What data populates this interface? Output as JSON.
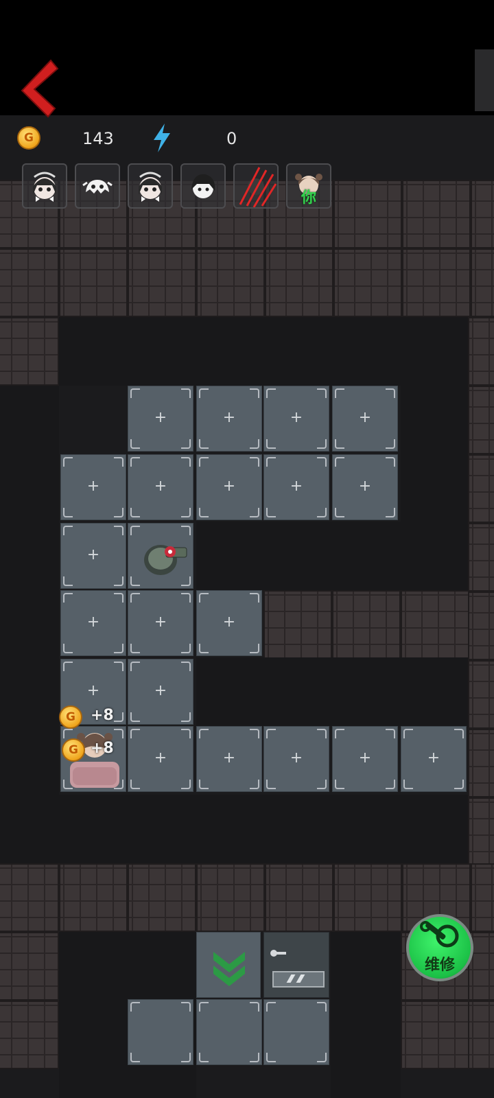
{
  "hud": {
    "gold_icon": "G",
    "gold_count": "143",
    "energy_icon": "lightning-bolt-icon",
    "energy_count": "0"
  },
  "avatars": [
    {
      "name": "girl-bunny-ears-avatar-icon"
    },
    {
      "name": "ghost-avatar-icon"
    },
    {
      "name": "girl-bunny-ears-avatar-icon"
    },
    {
      "name": "dark-hair-girl-avatar-icon"
    },
    {
      "name": "claw-scratch-avatar-icon"
    },
    {
      "name": "you-girl-avatar-icon",
      "label": "你"
    }
  ],
  "board": {
    "tile_symbol": "+",
    "gain_1": "+8",
    "gain_2": "+8",
    "gain_coin": "G"
  },
  "repair_button": {
    "label": "维修"
  },
  "colors": {
    "floor": "#566068",
    "repair": "#22c84a",
    "back_arrow": "#d01f1f"
  }
}
